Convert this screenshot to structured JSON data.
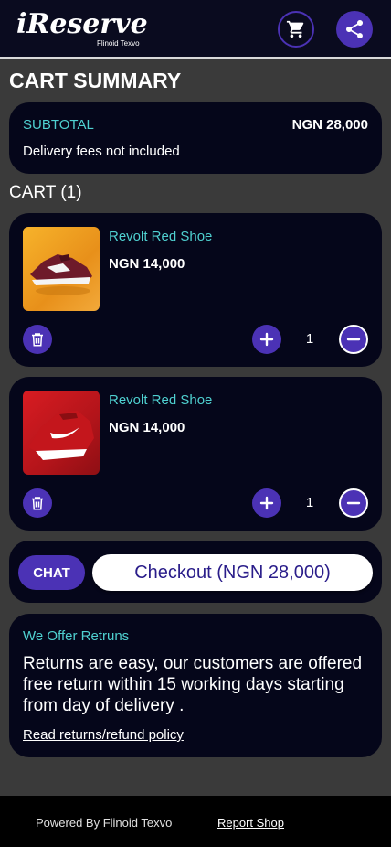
{
  "header": {
    "logo_text": "iReserve",
    "logo_subtitle": "Flinoid Texvo",
    "cart_icon": "cart-icon",
    "share_icon": "share-icon"
  },
  "summary": {
    "heading": "CART SUMMARY",
    "subtotal_label": "SUBTOTAL",
    "subtotal_value": "NGN 28,000",
    "delivery_note": "Delivery fees not included"
  },
  "cart": {
    "title": "CART (1)",
    "items": [
      {
        "name": "Revolt Red Shoe",
        "price": "NGN 14,000",
        "quantity": "1",
        "image": "maroon-sneaker-on-yellow-background"
      },
      {
        "name": "Revolt Red Shoe",
        "price": "NGN 14,000",
        "quantity": "1",
        "image": "red-running-shoe-on-red-background"
      }
    ]
  },
  "actions": {
    "chat_label": "CHAT",
    "checkout_label": "Checkout (NGN 28,000)"
  },
  "returns": {
    "title": "We Offer Retruns",
    "body": "Returns are easy, our customers are offered free return within 15 working days starting from day of delivery .",
    "link": "Read returns/refund policy"
  },
  "footer": {
    "powered": "Powered By Flinoid Texvo",
    "report": "Report Shop"
  },
  "colors": {
    "accent": "#4b32b5",
    "teal_text": "#4fd0d0",
    "card_bg": "#05061a",
    "page_bg": "#3a3a3a"
  }
}
